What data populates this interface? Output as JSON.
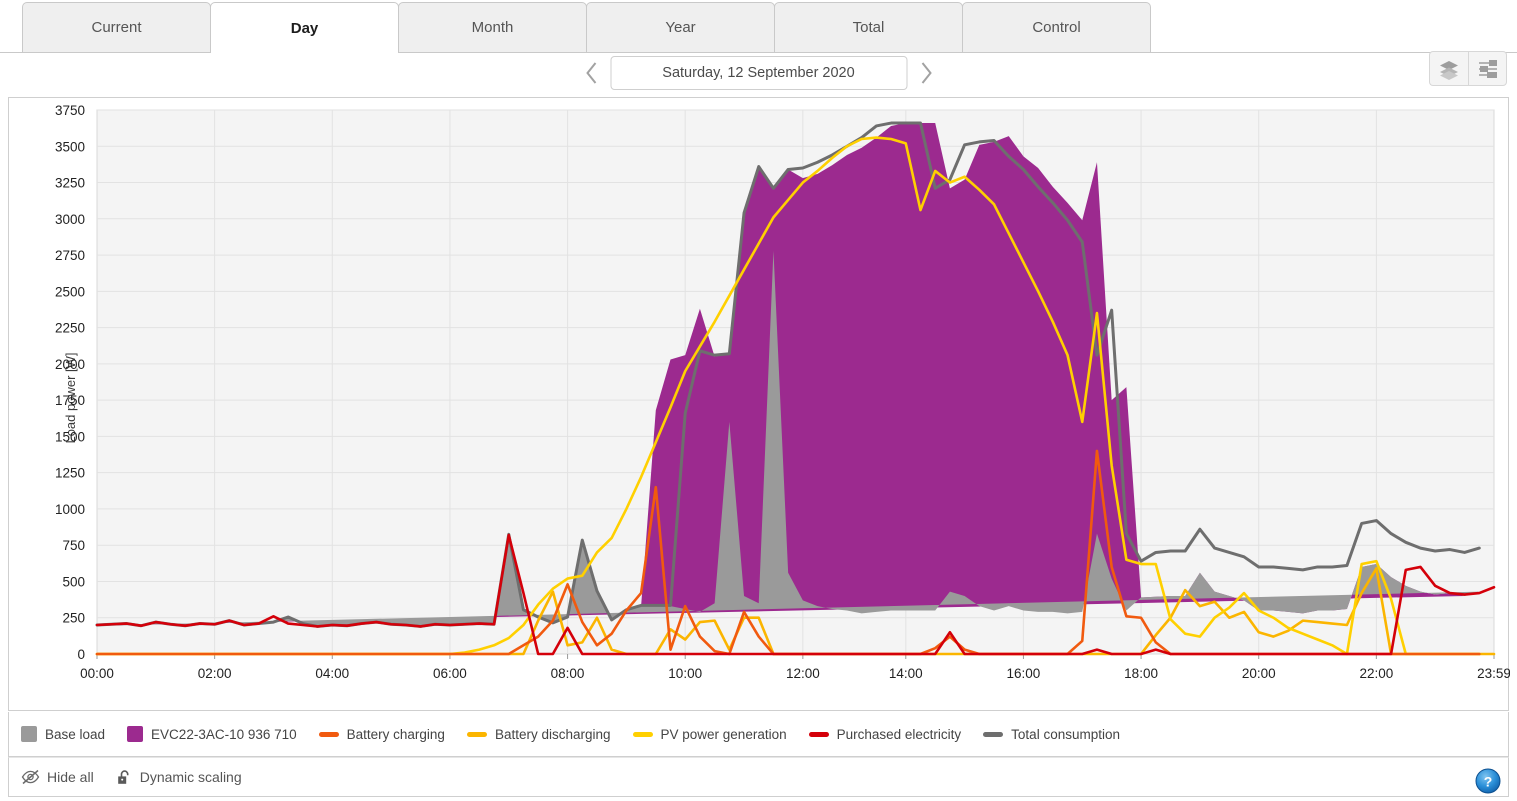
{
  "tabs": [
    {
      "label": "Current",
      "active": false
    },
    {
      "label": "Day",
      "active": true
    },
    {
      "label": "Month",
      "active": false
    },
    {
      "label": "Year",
      "active": false
    },
    {
      "label": "Total",
      "active": false
    },
    {
      "label": "Control",
      "active": false
    }
  ],
  "datebar": {
    "prev_label": "‹",
    "next_label": "›",
    "date": "Saturday, 12 September 2020"
  },
  "toolbar": {
    "layers_icon": "layers-icon",
    "settings_icon": "sliders-icon"
  },
  "footer": {
    "hide_all": "Hide all",
    "dynamic_scaling": "Dynamic scaling",
    "hide_icon": "eye-slash-icon",
    "lock_icon": "unlock-icon",
    "help_icon": "help-icon"
  },
  "legend": [
    {
      "label": "Base load",
      "color": "#9a9a9a",
      "style": "area"
    },
    {
      "label": "EVC22-3AC-10 936 710",
      "color": "#9c2a8f",
      "style": "area"
    },
    {
      "label": "Battery charging",
      "color": "#f15a0f",
      "style": "line"
    },
    {
      "label": "Battery discharging",
      "color": "#fbb500",
      "style": "line"
    },
    {
      "label": "PV power generation",
      "color": "#ffd000",
      "style": "line"
    },
    {
      "label": "Purchased electricity",
      "color": "#d4000a",
      "style": "line"
    },
    {
      "label": "Total consumption",
      "color": "#6e6e6e",
      "style": "line"
    }
  ],
  "chart_data": {
    "type": "area",
    "title": "",
    "xlabel": "",
    "ylabel": "Load power [W]",
    "ylim": [
      0,
      3750
    ],
    "yticks": [
      0,
      250,
      500,
      750,
      1000,
      1250,
      1500,
      1750,
      2000,
      2250,
      2500,
      2750,
      3000,
      3250,
      3500,
      3750
    ],
    "xlim": [
      "00:00",
      "23:59"
    ],
    "xticks": [
      "00:00",
      "02:00",
      "04:00",
      "06:00",
      "08:00",
      "10:00",
      "12:00",
      "14:00",
      "16:00",
      "18:00",
      "20:00",
      "22:00",
      "23:59"
    ],
    "grid": true,
    "legend_position": "bottom",
    "x": [
      "00:00",
      "00:15",
      "00:30",
      "00:45",
      "01:00",
      "01:15",
      "01:30",
      "01:45",
      "02:00",
      "02:15",
      "02:30",
      "02:45",
      "03:00",
      "03:15",
      "03:30",
      "03:45",
      "04:00",
      "04:15",
      "04:30",
      "04:45",
      "05:00",
      "05:15",
      "05:30",
      "05:45",
      "06:00",
      "06:15",
      "06:30",
      "06:45",
      "07:00",
      "07:15",
      "07:30",
      "07:45",
      "08:00",
      "08:15",
      "08:30",
      "08:45",
      "09:00",
      "09:15",
      "09:30",
      "09:45",
      "10:00",
      "10:15",
      "10:30",
      "10:45",
      "11:00",
      "11:15",
      "11:30",
      "11:45",
      "12:00",
      "12:15",
      "12:30",
      "12:45",
      "13:00",
      "13:15",
      "13:30",
      "13:45",
      "14:00",
      "14:15",
      "14:30",
      "14:45",
      "15:00",
      "15:15",
      "15:30",
      "15:45",
      "16:00",
      "16:15",
      "16:30",
      "16:45",
      "17:00",
      "17:15",
      "17:30",
      "17:45",
      "18:00",
      "18:15",
      "18:30",
      "18:45",
      "19:00",
      "19:15",
      "19:30",
      "19:45",
      "20:00",
      "20:15",
      "20:30",
      "20:45",
      "21:00",
      "21:15",
      "21:30",
      "21:45",
      "22:00",
      "22:15",
      "22:30",
      "22:45",
      "23:00",
      "23:15",
      "23:30",
      "23:59"
    ],
    "series": [
      {
        "name": "Base load",
        "type": "area",
        "color": "#9a9a9a",
        "values": [
          195,
          200,
          205,
          190,
          215,
          200,
          190,
          205,
          200,
          225,
          195,
          205,
          215,
          250,
          205,
          185,
          195,
          190,
          205,
          215,
          200,
          195,
          185,
          200,
          195,
          200,
          205,
          200,
          820,
          300,
          250,
          210,
          250,
          780,
          430,
          230,
          300,
          330,
          330,
          330,
          310,
          290,
          350,
          1600,
          400,
          350,
          2780,
          560,
          370,
          330,
          310,
          300,
          280,
          290,
          300,
          300,
          300,
          300,
          430,
          400,
          330,
          300,
          330,
          300,
          290,
          290,
          280,
          290,
          830,
          520,
          300,
          390,
          395,
          400,
          400,
          560,
          430,
          400,
          370,
          300,
          300,
          290,
          280,
          300,
          300,
          310,
          600,
          620,
          530,
          470,
          430,
          410,
          420,
          400,
          430
        ]
      },
      {
        "name": "EVC22-3AC-10 936 710",
        "type": "area",
        "color": "#9c2a8f",
        "values": [
          0,
          0,
          0,
          0,
          0,
          0,
          0,
          0,
          0,
          0,
          0,
          0,
          0,
          0,
          0,
          0,
          0,
          0,
          0,
          0,
          0,
          0,
          0,
          0,
          0,
          0,
          0,
          0,
          0,
          0,
          0,
          0,
          0,
          0,
          0,
          0,
          0,
          0,
          1350,
          1700,
          1750,
          2090,
          1700,
          470,
          2640,
          3010,
          430,
          2780,
          2910,
          2980,
          3060,
          3140,
          3210,
          3270,
          3340,
          3360,
          3360,
          3360,
          2780,
          2870,
          3180,
          3230,
          3240,
          3130,
          3060,
          2930,
          2830,
          2700,
          2560,
          1230,
          1540,
          0,
          0,
          0,
          0,
          0,
          0,
          0,
          0,
          0,
          0,
          0,
          0,
          0,
          0,
          0,
          0,
          0,
          0,
          0,
          0,
          0,
          0,
          0
        ]
      },
      {
        "name": "Total consumption",
        "type": "line",
        "color": "#6e6e6e",
        "values": [
          200,
          205,
          210,
          195,
          220,
          205,
          195,
          210,
          205,
          230,
          200,
          210,
          220,
          255,
          210,
          190,
          200,
          195,
          210,
          220,
          205,
          200,
          190,
          205,
          200,
          205,
          210,
          205,
          825,
          305,
          255,
          215,
          255,
          785,
          435,
          235,
          305,
          335,
          335,
          335,
          1660,
          2090,
          2060,
          2070,
          3040,
          3360,
          3210,
          3340,
          3350,
          3390,
          3440,
          3500,
          3560,
          3640,
          3660,
          3660,
          3660,
          3210,
          3270,
          3510,
          3530,
          3540,
          3430,
          3340,
          3220,
          3110,
          2990,
          2840,
          2060,
          2370,
          830,
          640,
          700,
          710,
          710,
          860,
          730,
          700,
          670,
          600,
          600,
          590,
          580,
          600,
          600,
          610,
          900,
          920,
          830,
          770,
          730,
          710,
          720,
          700,
          730
        ]
      },
      {
        "name": "PV power generation",
        "type": "line",
        "color": "#ffd000",
        "values": [
          0,
          0,
          0,
          0,
          0,
          0,
          0,
          0,
          0,
          0,
          0,
          0,
          0,
          0,
          0,
          0,
          0,
          0,
          0,
          0,
          0,
          0,
          0,
          0,
          0,
          10,
          30,
          60,
          110,
          200,
          340,
          450,
          520,
          540,
          700,
          800,
          1000,
          1220,
          1460,
          1700,
          1950,
          2120,
          2290,
          2470,
          2650,
          2830,
          3010,
          3130,
          3250,
          3330,
          3420,
          3500,
          3550,
          3560,
          3550,
          3520,
          3060,
          3330,
          3250,
          3290,
          3200,
          3100,
          2900,
          2700,
          2500,
          2290,
          2060,
          1600,
          2350,
          1300,
          650,
          620,
          620,
          240,
          140,
          120,
          250,
          320,
          420,
          300,
          250,
          180,
          140,
          100,
          60,
          0,
          620,
          640,
          380,
          0,
          0,
          0,
          0,
          0,
          0
        ]
      },
      {
        "name": "Battery charging",
        "type": "line",
        "color": "#f15a0f",
        "values": [
          0,
          0,
          0,
          0,
          0,
          0,
          0,
          0,
          0,
          0,
          0,
          0,
          0,
          0,
          0,
          0,
          0,
          0,
          0,
          0,
          0,
          0,
          0,
          0,
          0,
          0,
          0,
          0,
          0,
          60,
          120,
          230,
          480,
          220,
          60,
          140,
          300,
          420,
          1150,
          30,
          330,
          120,
          20,
          0,
          290,
          120,
          0,
          0,
          0,
          0,
          0,
          0,
          0,
          0,
          0,
          0,
          0,
          40,
          120,
          30,
          0,
          0,
          0,
          0,
          0,
          0,
          0,
          90,
          1400,
          600,
          260,
          250,
          80,
          0,
          0,
          0,
          0,
          0,
          0,
          0,
          0,
          0,
          0,
          0,
          0,
          0,
          0,
          0,
          0,
          0,
          0,
          0,
          0,
          0,
          0
        ]
      },
      {
        "name": "Battery discharging",
        "type": "line",
        "color": "#fbb500",
        "values": [
          0,
          0,
          0,
          0,
          0,
          0,
          0,
          0,
          0,
          0,
          0,
          0,
          0,
          0,
          0,
          0,
          0,
          0,
          0,
          0,
          0,
          0,
          0,
          0,
          0,
          0,
          0,
          0,
          0,
          0,
          230,
          430,
          60,
          80,
          250,
          30,
          0,
          0,
          0,
          170,
          100,
          220,
          230,
          30,
          250,
          250,
          0,
          0,
          0,
          0,
          0,
          0,
          0,
          0,
          0,
          0,
          0,
          0,
          0,
          0,
          0,
          0,
          0,
          0,
          0,
          0,
          0,
          0,
          0,
          0,
          0,
          0,
          130,
          250,
          440,
          330,
          360,
          250,
          290,
          150,
          120,
          160,
          230,
          220,
          210,
          200,
          420,
          590,
          0,
          0,
          0,
          0,
          0,
          0,
          0,
          0
        ]
      },
      {
        "name": "Purchased electricity",
        "type": "line",
        "color": "#d4000a",
        "values": [
          200,
          205,
          210,
          195,
          220,
          205,
          195,
          210,
          205,
          230,
          200,
          210,
          260,
          210,
          200,
          190,
          200,
          195,
          210,
          220,
          205,
          200,
          190,
          205,
          200,
          205,
          210,
          205,
          820,
          420,
          0,
          0,
          180,
          0,
          0,
          0,
          0,
          0,
          0,
          0,
          0,
          0,
          0,
          0,
          0,
          0,
          0,
          0,
          0,
          0,
          0,
          0,
          0,
          0,
          0,
          0,
          0,
          0,
          150,
          0,
          0,
          0,
          0,
          0,
          0,
          0,
          0,
          0,
          30,
          0,
          0,
          0,
          30,
          0,
          0,
          0,
          0,
          0,
          0,
          0,
          0,
          0,
          0,
          0,
          0,
          0,
          0,
          0,
          0,
          580,
          600,
          470,
          420,
          410,
          420,
          460
        ]
      }
    ]
  }
}
